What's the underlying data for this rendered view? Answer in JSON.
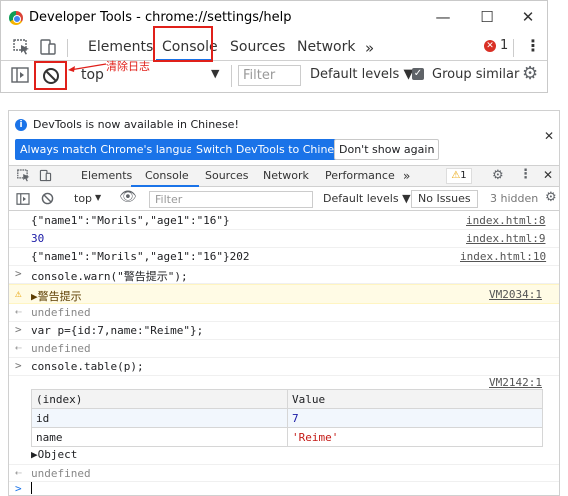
{
  "window1": {
    "title": "Developer Tools - chrome://settings/help",
    "tabs": [
      "Elements",
      "Console",
      "Sources",
      "Network"
    ],
    "more": "»",
    "error_count": "1",
    "filter_context": "top",
    "filter_placeholder": "Filter",
    "levels": "Default levels ▼",
    "group_similar": "Group similar",
    "annotation": "清除日志"
  },
  "infobar": {
    "text": "DevTools is now available in Chinese!",
    "btn_match": "Always match Chrome's language",
    "btn_switch": "Switch DevTools to Chinese",
    "btn_dont": "Don't show again"
  },
  "devtools": {
    "tabs": [
      "Elements",
      "Console",
      "Sources",
      "Network",
      "Performance"
    ],
    "more": "»",
    "warn_count": "1",
    "context": "top",
    "filter_placeholder": "Filter",
    "levels": "Default levels ▼",
    "no_issues": "No Issues",
    "hidden": "3 hidden"
  },
  "console": {
    "rows": [
      {
        "text": "{\"name1\":\"Morils\",\"age1\":\"16\"}",
        "link": "index.html:8"
      },
      {
        "text": "30",
        "link": "index.html:9"
      },
      {
        "text": "{\"name1\":\"Morils\",\"age1\":\"16\"}202",
        "link": "index.html:10"
      },
      {
        "text": "console.warn(\"警告提示\");",
        "link": ""
      },
      {
        "text": "▶警告提示",
        "link": "VM2034:1"
      },
      {
        "text": "undefined",
        "link": ""
      },
      {
        "text": "var p={id:7,name:\"Reime\"};",
        "link": ""
      },
      {
        "text": "undefined",
        "link": ""
      },
      {
        "text": "console.table(p);",
        "link": ""
      },
      {
        "text": "",
        "link": "VM2142:1"
      }
    ],
    "table": {
      "headers": [
        "(index)",
        "Value"
      ],
      "rows": [
        [
          "id",
          "7"
        ],
        [
          "name",
          "'Reime'"
        ]
      ]
    },
    "object_label": "▶Object",
    "final_undefined": "undefined"
  }
}
